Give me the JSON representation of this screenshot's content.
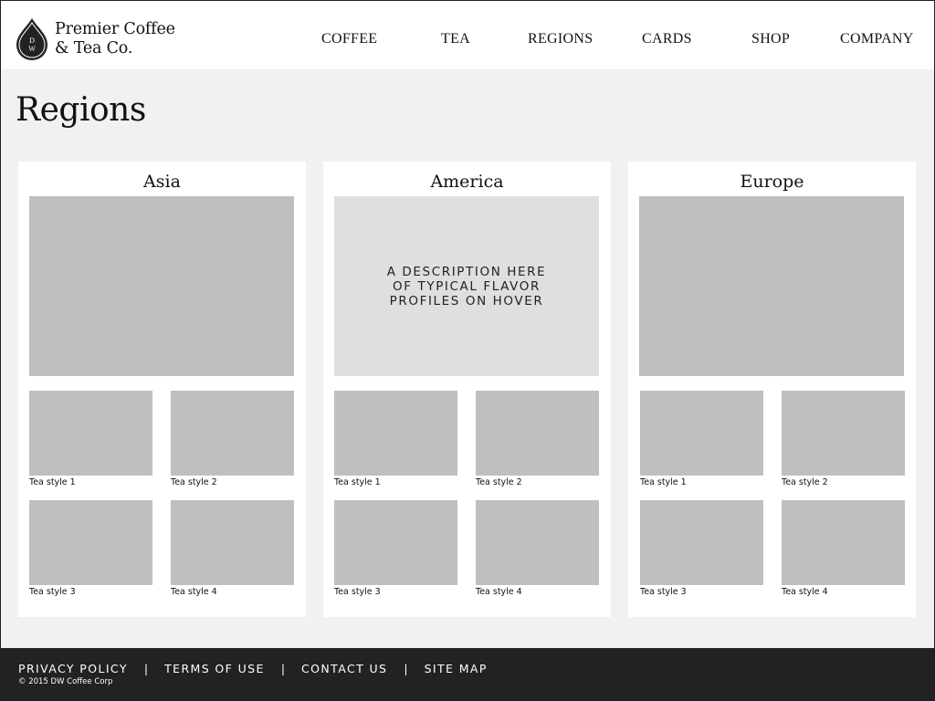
{
  "brand": {
    "name_line1": "Premier Coffee",
    "name_line2": "& Tea Co.",
    "monogram": "DW"
  },
  "nav": [
    {
      "label": "COFFEE"
    },
    {
      "label": "TEA"
    },
    {
      "label": "REGIONS"
    },
    {
      "label": "CARDS"
    },
    {
      "label": "SHOP"
    },
    {
      "label": "COMPANY"
    }
  ],
  "page": {
    "title": "Regions"
  },
  "regions": [
    {
      "name": "Asia",
      "hero_description": "",
      "styles": [
        "Tea style 1",
        "Tea style 2",
        "Tea style 3",
        "Tea style 4"
      ]
    },
    {
      "name": "America",
      "hero_description": "A DESCRIPTION HERE OF TYPICAL FLAVOR PROFILES ON HOVER",
      "styles": [
        "Tea style 1",
        "Tea style 2",
        "Tea style 3",
        "Tea style 4"
      ]
    },
    {
      "name": "Europe",
      "hero_description": "",
      "styles": [
        "Tea style 1",
        "Tea style 2",
        "Tea style 3",
        "Tea style 4"
      ]
    }
  ],
  "footer": {
    "links": [
      "PRIVACY POLICY",
      "TERMS OF USE",
      "CONTACT US",
      "SITE MAP"
    ],
    "separator": "|",
    "copyright": "© 2015 DW Coffee Corp"
  },
  "colors": {
    "placeholder": "#bfbfbf",
    "placeholder_hover": "#dfdfdf",
    "page_bg": "#f1f1f1",
    "footer_bg": "#222222"
  }
}
